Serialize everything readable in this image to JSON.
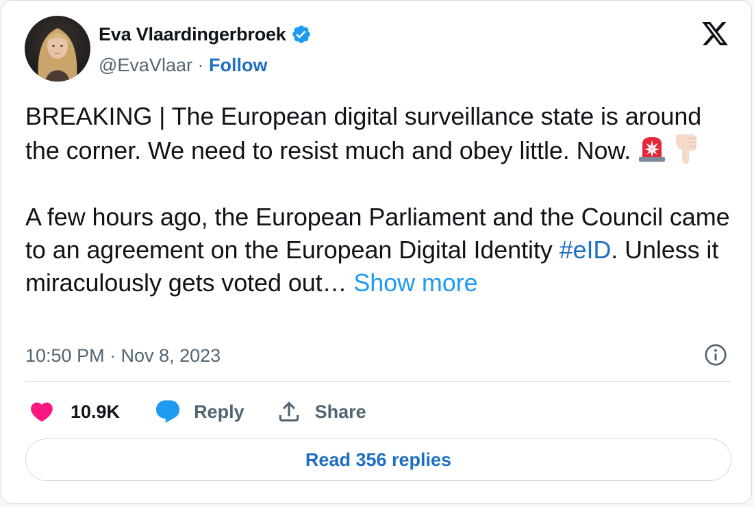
{
  "author": {
    "name": "Eva Vlaardingerbroek",
    "handle": "@EvaVlaar",
    "separator": " · ",
    "follow_label": "Follow",
    "verified": true
  },
  "tweet": {
    "line1": "BREAKING | The European digital surveillance state is around the corner. We need to resist much and obey little. Now.",
    "emojis": [
      "police-car-light-icon",
      "backhand-index-pointing-down-icon"
    ],
    "para2_text": "A few hours ago, the European Parliament and the Council came to an agreement on the European Digital Identity ",
    "hashtag": "#eID",
    "para2_tail": ". Unless it miraculously gets voted out…",
    "show_more": "Show more"
  },
  "timestamp": "10:50 PM · Nov 8, 2023",
  "actions": {
    "like_count": "10.9K",
    "reply_label": "Reply",
    "share_label": "Share"
  },
  "read_replies": "Read 356 replies",
  "colors": {
    "link_blue": "#1d6fc2",
    "show_more_blue": "#1d9bf0",
    "heart_pink": "#f91880",
    "reply_blue": "#1d9bf0",
    "secondary_text": "#536471",
    "border": "#cfd9de"
  },
  "icons": {
    "verified": "verified-badge-icon",
    "x_logo": "x-logo-icon",
    "info": "info-icon",
    "like": "heart-icon",
    "reply": "speech-bubble-icon",
    "share": "share-upload-icon"
  }
}
